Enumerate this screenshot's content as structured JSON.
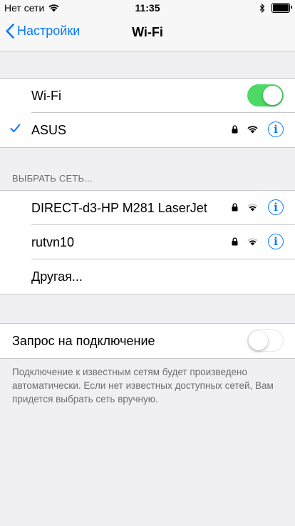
{
  "status_bar": {
    "carrier": "Нет сети",
    "time": "11:35"
  },
  "nav": {
    "back_label": "Настройки",
    "title": "Wi-Fi"
  },
  "wifi_toggle": {
    "label": "Wi-Fi",
    "on": true
  },
  "connected_network": {
    "name": "ASUS",
    "secured": true,
    "signal": "full"
  },
  "choose_network": {
    "header": "ВЫБРАТЬ СЕТЬ...",
    "networks": [
      {
        "name": "DIRECT-d3-HP M281 LaserJet",
        "secured": true,
        "signal": "medium"
      },
      {
        "name": "rutvn10",
        "secured": true,
        "signal": "medium"
      }
    ],
    "other_label": "Другая..."
  },
  "ask_to_join": {
    "label": "Запрос на подключение",
    "on": false,
    "note": "Подключение к известным сетям будет произведено автоматически. Если нет известных доступных сетей, Вам придется выбрать сеть вручную."
  },
  "colors": {
    "accent": "#0a7aff",
    "toggle_on": "#4cd964",
    "background": "#efeff4"
  }
}
